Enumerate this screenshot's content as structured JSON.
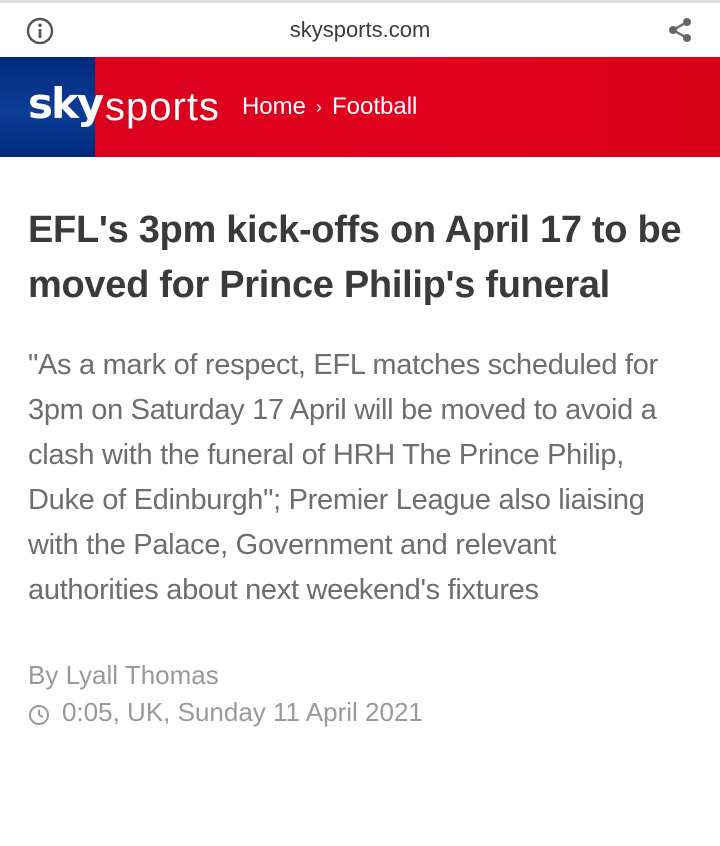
{
  "browser": {
    "domain": "skysports.com",
    "info_icon": "info-icon",
    "share_icon": "share-icon"
  },
  "header": {
    "logo_sky": "sky",
    "logo_sports": "sports",
    "breadcrumb": {
      "home": "Home",
      "separator": "›",
      "section": "Football"
    },
    "colors": {
      "red": "#e1001f",
      "blue": "#00287a"
    }
  },
  "article": {
    "headline": "EFL's 3pm kick-offs on April 17 to be moved for Prince Philip's funeral",
    "standfirst": "\"As a mark of respect, EFL matches scheduled for 3pm on Saturday 17 April will be moved to avoid a clash with the funeral of HRH The Prince Philip, Duke of Edinburgh\"; Premier League also liaising with the Palace, Government and relevant authorities about next weekend's fixtures",
    "byline": "By Lyall Thomas",
    "timestamp": "0:05, UK, Sunday 11 April 2021",
    "clock_icon": "clock-icon"
  }
}
